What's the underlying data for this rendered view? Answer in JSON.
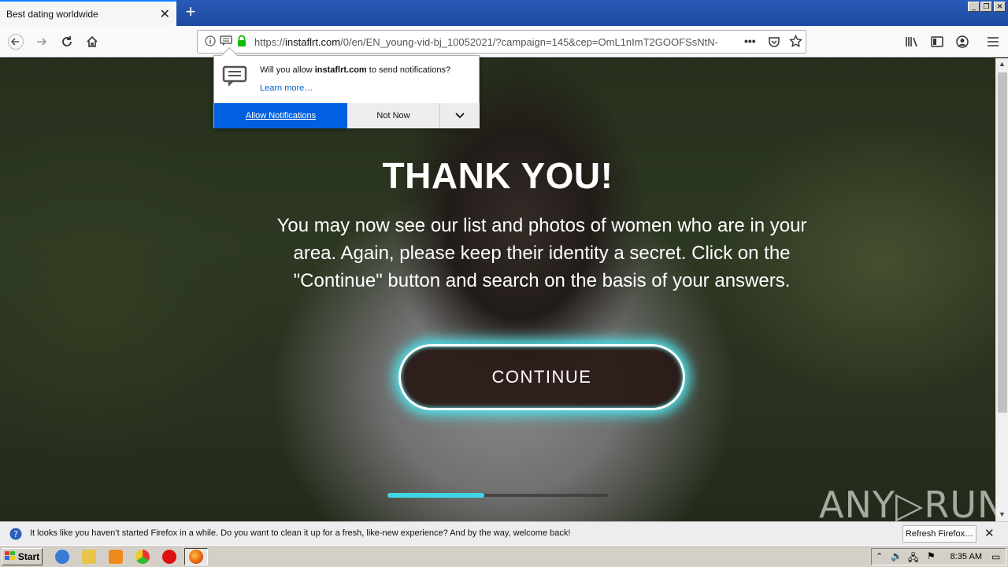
{
  "browser": {
    "tab_title": "Best dating worldwide",
    "url_prefix": "https://",
    "url_host": "instaflrt.com",
    "url_rest": "/0/en/EN_young-vid-bj_10052021/?campaign=145&cep=OmL1nImT2GOOFSsNtN-"
  },
  "popup": {
    "question_prefix": "Will you allow ",
    "question_host": "instaflrt.com",
    "question_suffix": " to send notifications?",
    "learn_more": "Learn more…",
    "allow_label": "Allow Notifications",
    "not_now_label": "Not Now"
  },
  "page": {
    "headline": "THANK YOU!",
    "message": "You may now see our list and photos of women who are in your area. Again, please keep their identity a secret. Click on the \"Continue\" button and search on the basis of your answers.",
    "continue_label": "CONTINUE",
    "progress_percent": 44,
    "watermark": "ANY▷RUN"
  },
  "notification_bar": {
    "text": "It looks like you haven’t started Firefox in a while. Do you want to clean it up for a fresh, like-new experience? And by the way, welcome back!",
    "refresh_label": "Refresh Firefox…"
  },
  "taskbar": {
    "start_label": "Start",
    "clock": "8:35 AM"
  },
  "colors": {
    "allow_button": "#0060df",
    "glow": "#4fe8f0",
    "progress": "#3ed6e6"
  }
}
